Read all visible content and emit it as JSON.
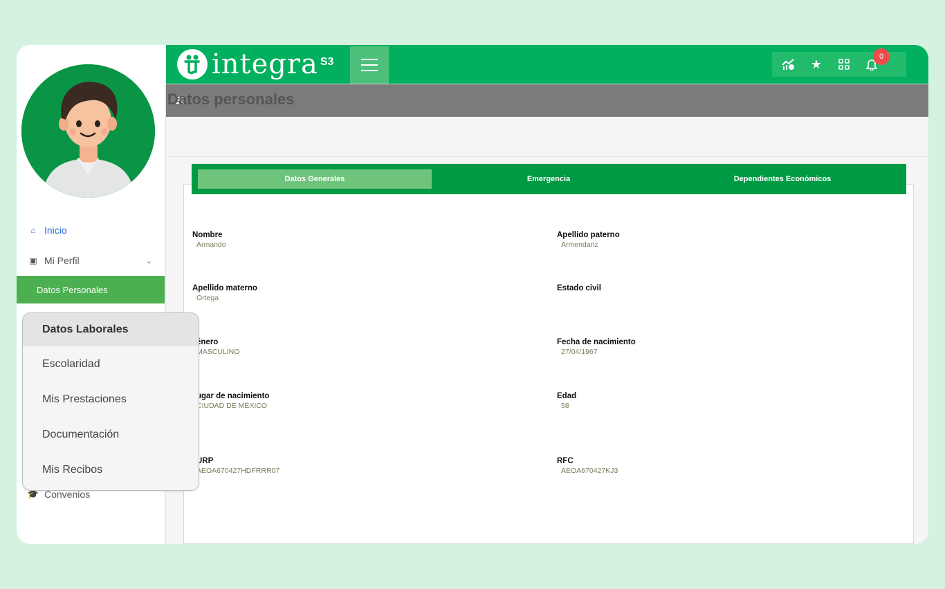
{
  "sidebar": {
    "items": [
      {
        "label": "Inicio",
        "icon": "home-icon"
      },
      {
        "label": "Mi Perfil",
        "icon": "id-card-icon"
      },
      {
        "label": "Datos Personales"
      },
      {
        "label": "Convenios",
        "icon": "graduation-cap-icon"
      }
    ]
  },
  "popup_menu": {
    "items": [
      "Datos Laborales",
      "Escolaridad",
      "Mis Prestaciones",
      "Documentación",
      "Mis Recibos"
    ]
  },
  "header": {
    "brand": "integra",
    "brand_mark": "S3",
    "notifications_count": "0",
    "colors": {
      "primary": "#00b05e",
      "tab_bar": "#009a44",
      "active_tab": "#6fc47b",
      "badge": "#f04b4b"
    }
  },
  "main": {
    "title": "Datos personales",
    "tabs": [
      "Datos Generales",
      "Emergencia",
      "Dependientes Económicos"
    ],
    "fields": [
      {
        "label": "Nombre",
        "value": "Armando"
      },
      {
        "label": "Apellido paterno",
        "value": "Armendariz"
      },
      {
        "label": "Apellido materno",
        "value": "Ortega"
      },
      {
        "label": "Estado civil",
        "value": ""
      },
      {
        "label": "énero",
        "value": "MASCULINO"
      },
      {
        "label": "Fecha de nacimiento",
        "value": "27/04/1967"
      },
      {
        "label": "ugar de nacimiento",
        "value": "CIUDAD DE MÉXICO"
      },
      {
        "label": "Edad",
        "value": "58"
      },
      {
        "label": "URP",
        "value": "AEOA670427HDFRRR07"
      },
      {
        "label": "RFC",
        "value": "AEOA670427KJ3"
      }
    ]
  }
}
